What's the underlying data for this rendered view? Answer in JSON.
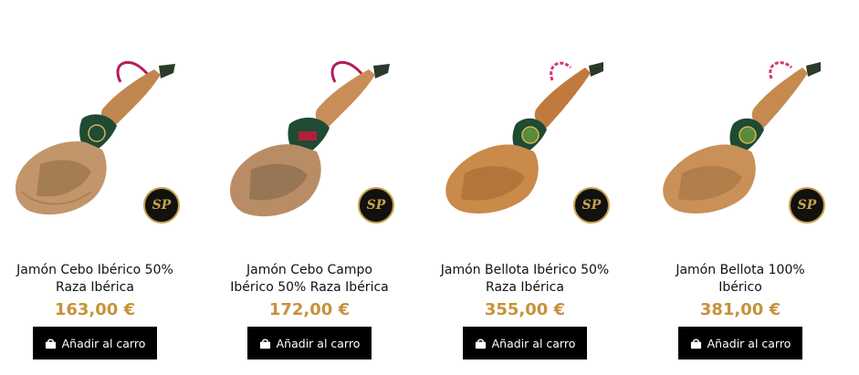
{
  "products": [
    {
      "title_line1": "Jamón Cebo Ibérico 50%",
      "title_line2": "Raza Ibérica",
      "price": "163,00 €",
      "button_label": "Añadir al carro",
      "logo_text": "SP"
    },
    {
      "title_line1": "Jamón Cebo Campo",
      "title_line2": "Ibérico 50% Raza Ibérica",
      "price": "172,00 €",
      "button_label": "Añadir al carro",
      "logo_text": "SP"
    },
    {
      "title_line1": "Jamón Bellota Ibérico 50%",
      "title_line2": "Raza Ibérica",
      "price": "355,00 €",
      "button_label": "Añadir al carro",
      "logo_text": "SP"
    },
    {
      "title_line1": "Jamón Bellota 100%",
      "title_line2": "Ibérico",
      "price": "381,00 €",
      "button_label": "Añadir al carro",
      "logo_text": "SP"
    }
  ],
  "colors": {
    "price": "#c8923a",
    "button_bg": "#000000",
    "button_text": "#ffffff",
    "logo_bg": "#111111",
    "logo_ring": "#c9a24b"
  },
  "icons": {
    "button_icon": "shopping-bag-icon"
  }
}
